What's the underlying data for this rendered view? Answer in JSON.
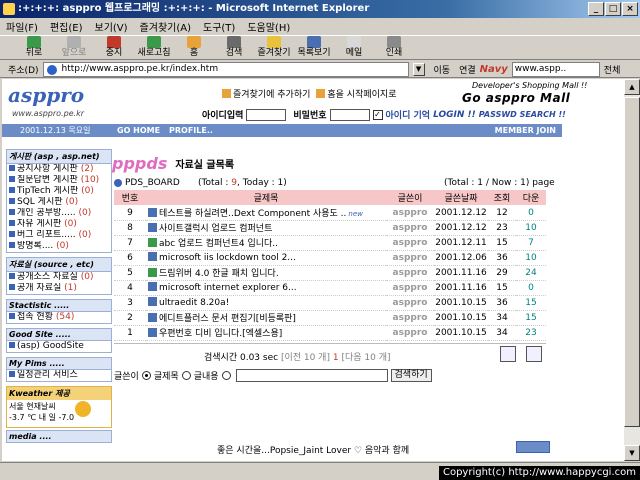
{
  "window": {
    "title": ":+:+:+: asppro 웹프로그래밍 :+:+:+: - Microsoft Internet Explorer",
    "btn_min": "_",
    "btn_max": "□",
    "btn_close": "×"
  },
  "menu": [
    "파일(F)",
    "편집(E)",
    "보기(V)",
    "즐겨찾기(A)",
    "도구(T)",
    "도움말(H)"
  ],
  "toolbar": {
    "back": "뒤로",
    "forward": "앞으로",
    "stop": "중지",
    "refresh": "새로고침",
    "home": "홈",
    "search": "검색",
    "favorites": "즐겨찾기",
    "history": "목록보기",
    "mail": "메일",
    "print": "인쇄"
  },
  "address": {
    "label": "주소(D)",
    "url": "http://www.asppro.pe.kr/index.htm",
    "go": "이동",
    "links": "연결",
    "navy": "Navy",
    "search_value": "www.aspp..",
    "search_opt": "전체"
  },
  "site": {
    "logo": "asppro",
    "logo_url": "www.asppro.pe.kr",
    "fav_add": "즐겨찾기에 추가하기",
    "homepage": "홈을 시작페이지로",
    "mall_small": "Developer's Shopping Mall !!",
    "mall": "Go asppro Mall",
    "id_label": "아이디입력",
    "pw_label": "비밀번호",
    "remember_label": "아이디 기억",
    "login": "LOGIN !!",
    "pw_search": "PASSWD SEARCH !!",
    "date": "2001.12.13  목요일",
    "nav_home": "GO HOME",
    "nav_profile": "PROFILE..",
    "nav_join": "MEMBER JOIN"
  },
  "sidebar": {
    "board_head": "게시판 (asp , asp.net)",
    "boards": [
      {
        "label": "공지사항 게시판",
        "count": "(2)"
      },
      {
        "label": "질문답변 게시판",
        "count": "(10)"
      },
      {
        "label": "TipTech 게시판",
        "count": "(0)"
      },
      {
        "label": "SQL 게시판",
        "count": "(0)"
      },
      {
        "label": "개인 공부방.....",
        "count": "(0)"
      },
      {
        "label": "자유 게시판",
        "count": "(0)"
      },
      {
        "label": "버그 리포트.....",
        "count": "(0)"
      },
      {
        "label": "방명록....",
        "count": "(0)"
      }
    ],
    "source_head": "자료실 (source , etc)",
    "sources": [
      {
        "label": "공개소스 자료실",
        "count": "(0)"
      },
      {
        "label": "공개 자료실",
        "count": "(1)"
      }
    ],
    "stat_head": "Stactistic .....",
    "stats": [
      {
        "label": "접속 현황",
        "count": "(54)"
      }
    ],
    "good_head": "Good Site .....",
    "goods": [
      {
        "label": "(asp) GoodSite",
        "count": ""
      }
    ],
    "pims_head": "My Pims .....",
    "pims": [
      {
        "label": "일정관리 서비스",
        "count": ""
      }
    ],
    "weather_head": "Kweather 제공",
    "weather_city": "서울 현재날씨",
    "weather_temp": "-3.7",
    "weather_low": "-7.0",
    "weather_unit": "℃",
    "weather_day1": "내",
    "weather_day2": "일",
    "media_head": "media ...."
  },
  "board": {
    "logo_text": "pppds",
    "subtitle": "자료실 글목록",
    "name": "PDS_BOARD",
    "total_prefix": "(Total : ",
    "total": "9",
    "today_prefix": ", Today : ",
    "today": "1",
    "stat_suffix": ")",
    "page_info": "(Total : 1 / Now : 1) page",
    "cols": {
      "no": "번호",
      "title": "글제목",
      "author": "글쓴이",
      "date": "글쓴날짜",
      "views": "조회",
      "down": "다운"
    },
    "rows": [
      {
        "no": "9",
        "title": "테스트를 하실려면..Dext Component 사용도 ..",
        "new": "new",
        "author": "asppro",
        "date": "2001.12.12",
        "views": "12",
        "down": "0"
      },
      {
        "no": "8",
        "title": "사이트갤럭시 업로드 컴퍼넌트",
        "new": "",
        "author": "asppro",
        "date": "2001.12.12",
        "views": "23",
        "down": "10"
      },
      {
        "no": "7",
        "title": "abc 업로드 컴퍼넌트4 입니다..",
        "new": "",
        "author": "asppro",
        "date": "2001.12.11",
        "views": "15",
        "down": "7"
      },
      {
        "no": "6",
        "title": "microsoft iis lockdown tool 2...",
        "new": "",
        "author": "asppro",
        "date": "2001.12.06",
        "views": "36",
        "down": "10"
      },
      {
        "no": "5",
        "title": "드림위버 4.0 한글 패치 입니다.",
        "new": "",
        "author": "asppro",
        "date": "2001.11.16",
        "views": "29",
        "down": "24"
      },
      {
        "no": "4",
        "title": "microsoft internet explorer 6...",
        "new": "",
        "author": "asppro",
        "date": "2001.11.16",
        "views": "15",
        "down": "0"
      },
      {
        "no": "3",
        "title": "ultraedit 8.20a!",
        "new": "",
        "author": "asppro",
        "date": "2001.10.15",
        "views": "36",
        "down": "15"
      },
      {
        "no": "2",
        "title": "에디트플러스 문서 편집기[비등록판]",
        "new": "",
        "author": "asppro",
        "date": "2001.10.15",
        "views": "34",
        "down": "15"
      },
      {
        "no": "1",
        "title": "우편번호 디비 입니다.[엑셀스용]",
        "new": "",
        "author": "asppro",
        "date": "2001.10.15",
        "views": "34",
        "down": "23"
      }
    ],
    "search_time": "검색시간 0.03 sec",
    "prev10": "[이전 10 개]",
    "cur_page": "1",
    "next10": "[다음 10 개]",
    "search_by": "글쓴이",
    "opt_title": "글제목",
    "opt_body": "글내용",
    "search_btn": "검색하기"
  },
  "footer": {
    "text": "좋은 시간을...Popsie_Jaint Lover ♡ 음악과 함께"
  },
  "copyright": "Copyright(c) http://www.happycgi.com"
}
